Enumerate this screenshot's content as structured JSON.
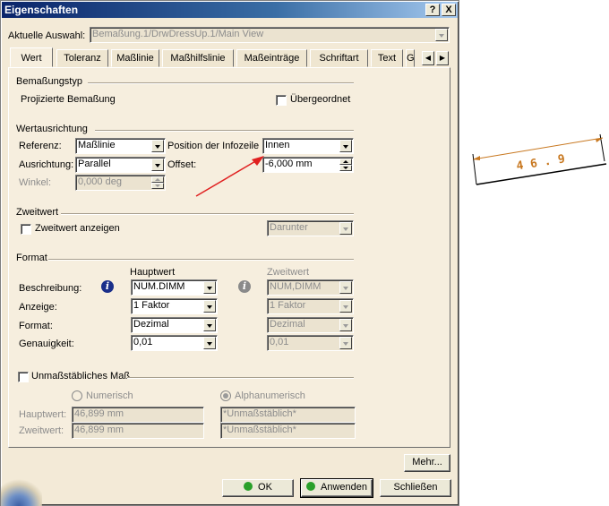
{
  "window": {
    "title": "Eigenschaften",
    "help_glyph": "?",
    "close_glyph": "X"
  },
  "selection": {
    "label": "Aktuelle Auswahl:",
    "value": "Bemaßung.1/DrwDressUp.1/Main View"
  },
  "tabs": [
    {
      "label": "Wert",
      "active": true
    },
    {
      "label": "Toleranz"
    },
    {
      "label": "Maßlinie"
    },
    {
      "label": "Maßhilfslinie"
    },
    {
      "label": "Maßeinträge"
    },
    {
      "label": "Schriftart"
    },
    {
      "label": "Text"
    },
    {
      "label": "G"
    }
  ],
  "dimtype": {
    "group_title": "Bemaßungstyp",
    "type_text": "Projizierte Bemaßung",
    "parent_label": "Übergeordnet"
  },
  "orientation": {
    "group_title": "Wertausrichtung",
    "ref_label": "Referenz:",
    "ref_value": "Maßlinie",
    "pos_label": "Position der Infozeile",
    "pos_value": "Innen",
    "align_label": "Ausrichtung:",
    "align_value": "Parallel",
    "offset_label": "Offset:",
    "offset_value": "-6,000 mm",
    "angle_label": "Winkel:",
    "angle_value": "0,000 deg"
  },
  "secondary": {
    "group_title": "Zweitwert",
    "show_label": "Zweitwert anzeigen",
    "placement_value": "Darunter"
  },
  "format": {
    "group_title": "Format",
    "main_header": "Hauptwert",
    "second_header": "Zweitwert",
    "rows": [
      {
        "label": "Beschreibung:",
        "main": "NUM.DIMM",
        "second": "NUM,DIMM"
      },
      {
        "label": "Anzeige:",
        "main": "1 Faktor",
        "second": "1 Faktor"
      },
      {
        "label": "Format:",
        "main": "Dezimal",
        "second": "Dezimal"
      },
      {
        "label": "Genauigkeit:",
        "main": "0,01",
        "second": "0,01"
      }
    ]
  },
  "fake": {
    "checkbox_label": "Unmaßstäbliches Maß",
    "numeric_label": "Numerisch",
    "alnum_label": "Alphanumerisch",
    "main_label": "Hauptwert:",
    "second_label": "Zweitwert:",
    "main_num": "46,899 mm",
    "second_num": "46,899 mm",
    "main_alnum": "*Unmaßstäblich*",
    "second_alnum": "*Unmaßstäblich*"
  },
  "buttons": {
    "more": "Mehr...",
    "ok": "OK",
    "apply": "Anwenden",
    "close": "Schließen"
  },
  "drawing": {
    "dimension_text": "4 6 . 9"
  },
  "colors": {
    "arrow": "#e02020",
    "dimension": "#c87820",
    "ok_led": "#2aa02a",
    "info_icon": "#1a2f8a"
  }
}
